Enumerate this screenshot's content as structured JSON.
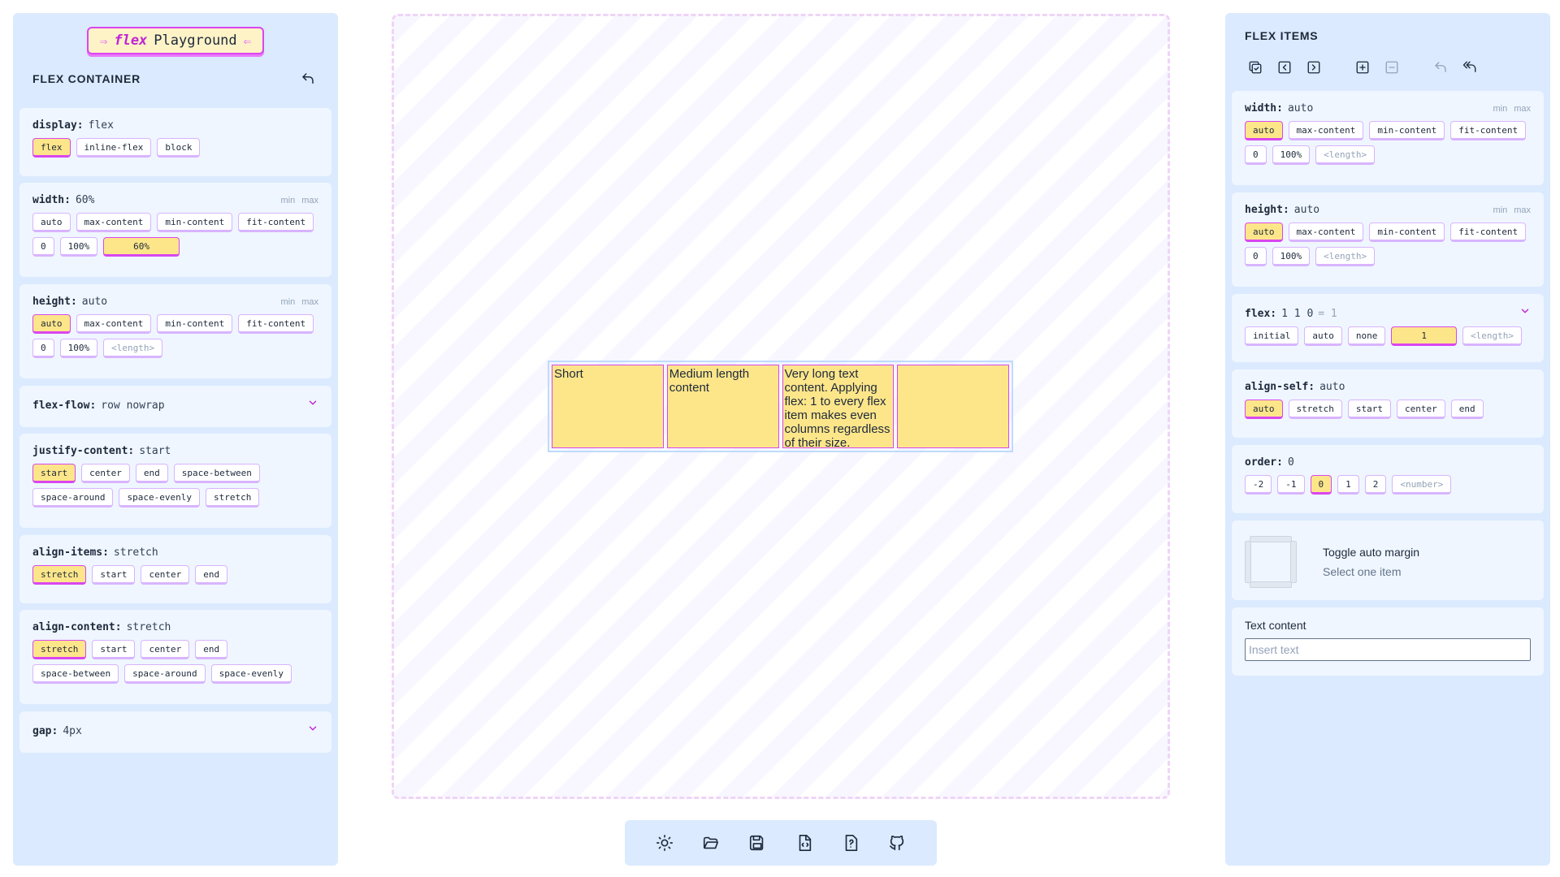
{
  "logo": {
    "arrow_left": "⇒",
    "flex_word": "flex",
    "playground_word": "Playground",
    "arrow_right": "⇐"
  },
  "container_panel": {
    "title": "FLEX CONTAINER",
    "display": {
      "name": "display:",
      "value": "flex",
      "options": [
        "flex",
        "inline-flex",
        "block"
      ],
      "active": "flex"
    },
    "width": {
      "name": "width:",
      "value": "60%",
      "min": "min",
      "max": "max",
      "options_row1": [
        "auto",
        "max-content",
        "min-content",
        "fit-content"
      ],
      "options_row2": [
        "0",
        "100%"
      ],
      "input_value": "60%",
      "active": "60%"
    },
    "height": {
      "name": "height:",
      "value": "auto",
      "min": "min",
      "max": "max",
      "options_row1": [
        "auto",
        "max-content",
        "min-content",
        "fit-content"
      ],
      "options_row2": [
        "0",
        "100%"
      ],
      "length_placeholder": "<length>",
      "active": "auto"
    },
    "flex_flow": {
      "name": "flex-flow:",
      "value": "row nowrap"
    },
    "justify_content": {
      "name": "justify-content:",
      "value": "start",
      "options": [
        "start",
        "center",
        "end",
        "space-between",
        "space-around",
        "space-evenly",
        "stretch"
      ],
      "active": "start"
    },
    "align_items": {
      "name": "align-items:",
      "value": "stretch",
      "options": [
        "stretch",
        "start",
        "center",
        "end"
      ],
      "active": "stretch"
    },
    "align_content": {
      "name": "align-content:",
      "value": "stretch",
      "options": [
        "stretch",
        "start",
        "center",
        "end",
        "space-between",
        "space-around",
        "space-evenly"
      ],
      "active": "stretch"
    },
    "gap": {
      "name": "gap:",
      "value": "4px"
    }
  },
  "canvas": {
    "items": [
      "Short",
      "Medium length content",
      "Very long text content. Applying flex: 1 to every flex item makes even columns regardless of their size.",
      ""
    ]
  },
  "toolbar": {
    "icons": [
      "sun-icon",
      "folder-open-icon",
      "save-icon",
      "code-file-icon",
      "help-icon",
      "github-icon"
    ]
  },
  "items_panel": {
    "title": "FLEX ITEMS",
    "width": {
      "name": "width:",
      "value": "auto",
      "min": "min",
      "max": "max",
      "options_row1": [
        "auto",
        "max-content",
        "min-content",
        "fit-content"
      ],
      "options_row2": [
        "0",
        "100%"
      ],
      "length_placeholder": "<length>",
      "active": "auto"
    },
    "height": {
      "name": "height:",
      "value": "auto",
      "min": "min",
      "max": "max",
      "options_row1": [
        "auto",
        "max-content",
        "min-content",
        "fit-content"
      ],
      "options_row2": [
        "0",
        "100%"
      ],
      "length_placeholder": "<length>",
      "active": "auto"
    },
    "flex": {
      "name": "flex:",
      "value": "1 1 0",
      "equals": "= 1",
      "options": [
        "initial",
        "auto",
        "none"
      ],
      "input_value": "1",
      "length_placeholder": "<length>"
    },
    "align_self": {
      "name": "align-self:",
      "value": "auto",
      "options": [
        "auto",
        "stretch",
        "start",
        "center",
        "end"
      ],
      "active": "auto"
    },
    "order": {
      "name": "order:",
      "value": "0",
      "options": [
        "-2",
        "-1",
        "0",
        "1",
        "2"
      ],
      "number_placeholder": "<number>",
      "active": "0"
    },
    "margin": {
      "title": "Toggle auto margin",
      "subtitle": "Select one item"
    },
    "text_content": {
      "label": "Text content",
      "placeholder": "Insert text"
    }
  },
  "colors": {
    "panel_bg": "#dbeafe",
    "card_bg": "#eff6ff",
    "chip_active": "#fde68a",
    "accent": "#d946ef"
  }
}
